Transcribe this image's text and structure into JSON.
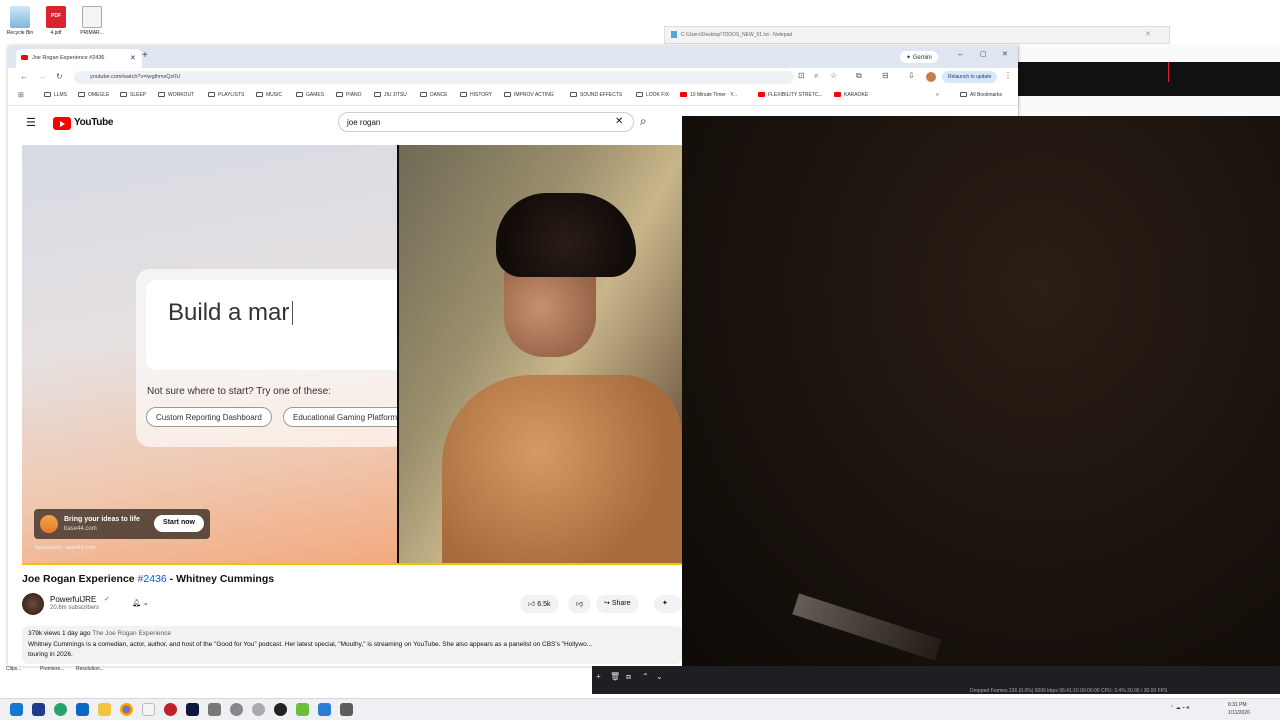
{
  "desktop": {
    "icons": [
      {
        "label": "Recycle Bin",
        "icon": "recycle-bin-icon"
      },
      {
        "label": "4.pdf",
        "icon": "pdf-icon"
      },
      {
        "label": "PRIMAR...",
        "icon": "document-icon"
      }
    ],
    "bottom_labels": [
      "Clips...",
      "Premiere...",
      "Resolution..."
    ]
  },
  "notepad": {
    "title": "C:\\Users\\Desktop\\TODOS_NEW_01.txt - Notepad"
  },
  "browser": {
    "tab_title": "Joe Rogan Experience #2436",
    "gemini_label": "Gemini",
    "url": "youtube.com/watch?v=iwglhmsQz0U",
    "relaunch_label": "Relaunch to update",
    "bookmarks": [
      "LLMS",
      "OMEGLE",
      "SLEEP",
      "WORKOUT",
      "PLAYLISTS",
      "MUSIC",
      "GAMES",
      "PIANO",
      "JIU JITSU",
      "DANCE",
      "HISTORY",
      "IMPROV ACTING",
      "SOUND EFFECTS",
      "LOOK FIX",
      "10 Minute Timer · Y...",
      "FLEXIBILITY STRETC...",
      "KARAOKE"
    ],
    "all_bookmarks": "All Bookmarks"
  },
  "youtube": {
    "logo_text": "YouTube",
    "search_query": "joe rogan",
    "ad": {
      "typed_text": "Build a mar",
      "hint": "Not sure where to start? Try one of these:",
      "chips": [
        "Custom Reporting Dashboard",
        "Educational Gaming Platform"
      ],
      "headline": "Bring your ideas to life",
      "url": "base44.com",
      "cta": "Start now",
      "sponsored": "Sponsored · base44.com"
    },
    "video": {
      "title_prefix": "Joe Rogan Experience",
      "episode": "#2436",
      "title_suffix": "- Whitney Cummings",
      "channel": "PowerfulJRE",
      "subscribers": "20.6m subscribers",
      "likes": "6.5k",
      "share": "Share",
      "views_meta": "379k views  1 day ago",
      "playlist": "The Joe Rogan Experience",
      "description": "Whitney Cummings is a comedian, actor, author, and host of the \"Good for You\" podcast. Her latest special, \"Mouthy,\" is streaming on YouTube. She also appears as a panelist on CBS's \"Hollywo...",
      "description_line2": "touring in 2026."
    }
  },
  "obs": {
    "status": "Dropped Frames 236 (0.0%)   6006 kbps   06:41:10   00:00:00   CPU: 3.4%   30.00 / 30.00 FPS"
  },
  "taskbar": {
    "time": "6:31 PM",
    "date": "1/11/2026"
  },
  "colors": {
    "youtube_red": "#ff0000",
    "link_blue": "#065fd4",
    "progress_yellow": "#f2c200"
  }
}
